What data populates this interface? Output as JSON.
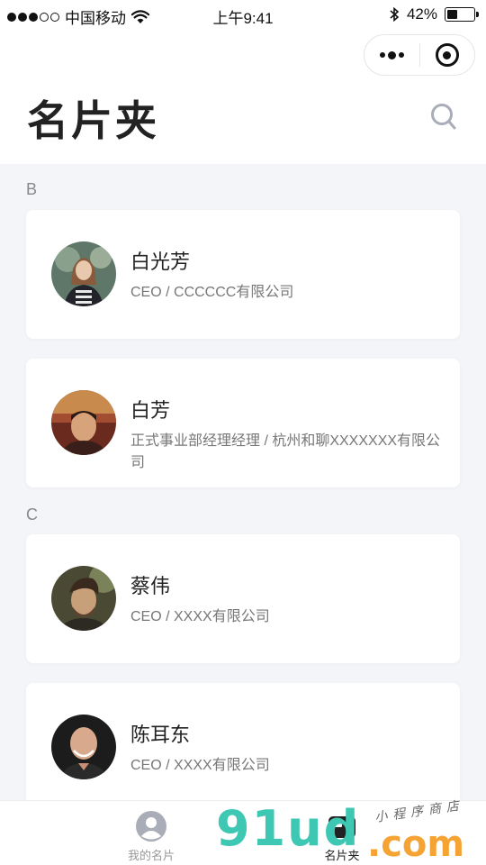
{
  "status_bar": {
    "carrier": "中国移动",
    "time": "上午9:41",
    "battery_percent": "42%",
    "battery_level": 0.42,
    "signal_bars_filled": 3,
    "signal_bars_total": 5,
    "wifi_icon": "wifi-icon",
    "bluetooth_icon": "bluetooth-icon"
  },
  "capsule": {
    "more_icon": "more-dots-icon",
    "close_icon": "target-close-icon"
  },
  "header": {
    "title": "名片夹",
    "search_icon": "search-icon"
  },
  "sections": [
    {
      "letter": "B",
      "cards": [
        {
          "name": "白光芳",
          "meta": "CEO / CCCCCC有限公司",
          "avatar": "avatar-photo"
        },
        {
          "name": "白芳",
          "meta": "正式事业部经理经理 / 杭州和聊XXXXXXX有限公司",
          "avatar": "avatar-photo"
        }
      ]
    },
    {
      "letter": "C",
      "cards": [
        {
          "name": "蔡伟",
          "meta": "CEO / XXXX有限公司",
          "avatar": "avatar-photo"
        },
        {
          "name": "陈耳东",
          "meta": "CEO / XXXX有限公司",
          "avatar": "avatar-photo"
        }
      ]
    }
  ],
  "tabbar": {
    "tabs": [
      {
        "label": "我的名片",
        "icon": "user-icon",
        "active": false
      },
      {
        "label": "名片夹",
        "icon": "card-holder-icon",
        "active": true
      }
    ]
  },
  "watermark": {
    "brand": "91ud",
    "domain": ".com",
    "tagline": "小程序商店"
  },
  "colors": {
    "background": "#f4f5f9",
    "card": "#ffffff",
    "title": "#222222",
    "meta": "#777777",
    "watermark_green": "#3ec7b3",
    "watermark_orange": "#f5a434"
  }
}
